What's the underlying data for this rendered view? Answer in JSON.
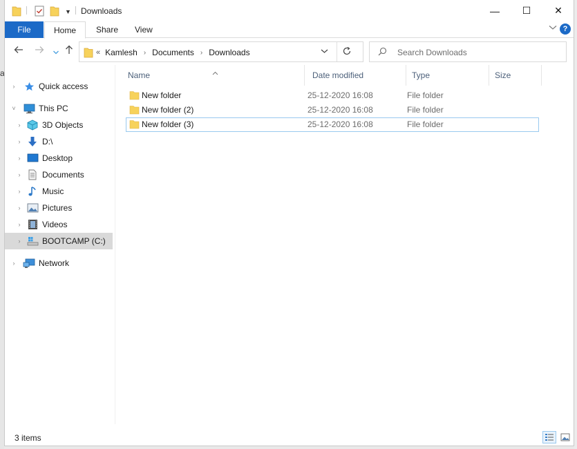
{
  "window": {
    "title": "Downloads",
    "controls": {
      "minimize": "—",
      "maximize": "☐",
      "close": "✕"
    }
  },
  "ribbon": {
    "tabs": [
      {
        "label": "File"
      },
      {
        "label": "Home"
      },
      {
        "label": "Share"
      },
      {
        "label": "View"
      }
    ],
    "help": "?"
  },
  "address": {
    "lead": "«",
    "crumbs": [
      "Kamlesh",
      "Documents",
      "Downloads"
    ]
  },
  "search": {
    "placeholder": "Search Downloads"
  },
  "sidebar": {
    "items": [
      {
        "label": "Quick access",
        "icon": "star-icon",
        "indent": 0,
        "expand": "›"
      },
      {
        "label": "This PC",
        "icon": "computer-icon",
        "indent": 0,
        "expand": "˅"
      },
      {
        "label": "3D Objects",
        "icon": "cube-icon",
        "indent": 1,
        "expand": "›"
      },
      {
        "label": "D:\\",
        "icon": "download-arrow-icon",
        "indent": 1,
        "expand": "›"
      },
      {
        "label": "Desktop",
        "icon": "desktop-icon",
        "indent": 1,
        "expand": "›"
      },
      {
        "label": "Documents",
        "icon": "document-icon",
        "indent": 1,
        "expand": "›"
      },
      {
        "label": "Music",
        "icon": "music-note-icon",
        "indent": 1,
        "expand": "›"
      },
      {
        "label": "Pictures",
        "icon": "picture-icon",
        "indent": 1,
        "expand": "›"
      },
      {
        "label": "Videos",
        "icon": "film-icon",
        "indent": 1,
        "expand": "›"
      },
      {
        "label": "BOOTCAMP (C:)",
        "icon": "drive-icon",
        "indent": 1,
        "expand": "›"
      },
      {
        "label": "Network",
        "icon": "network-icon",
        "indent": 0,
        "expand": "›"
      }
    ]
  },
  "list": {
    "columns": [
      "Name",
      "Date modified",
      "Type",
      "Size"
    ],
    "rows": [
      {
        "name": "New folder",
        "date": "25-12-2020 16:08",
        "type": "File folder",
        "size": ""
      },
      {
        "name": "New folder (2)",
        "date": "25-12-2020 16:08",
        "type": "File folder",
        "size": ""
      },
      {
        "name": "New folder (3)",
        "date": "25-12-2020 16:08",
        "type": "File folder",
        "size": ""
      }
    ]
  },
  "status": {
    "items_text": "3 items"
  },
  "colors": {
    "accent": "#1c6ac7",
    "folder": "#f7d25b",
    "selection": "#d9d9d9",
    "focus_border": "#99c9ef"
  }
}
